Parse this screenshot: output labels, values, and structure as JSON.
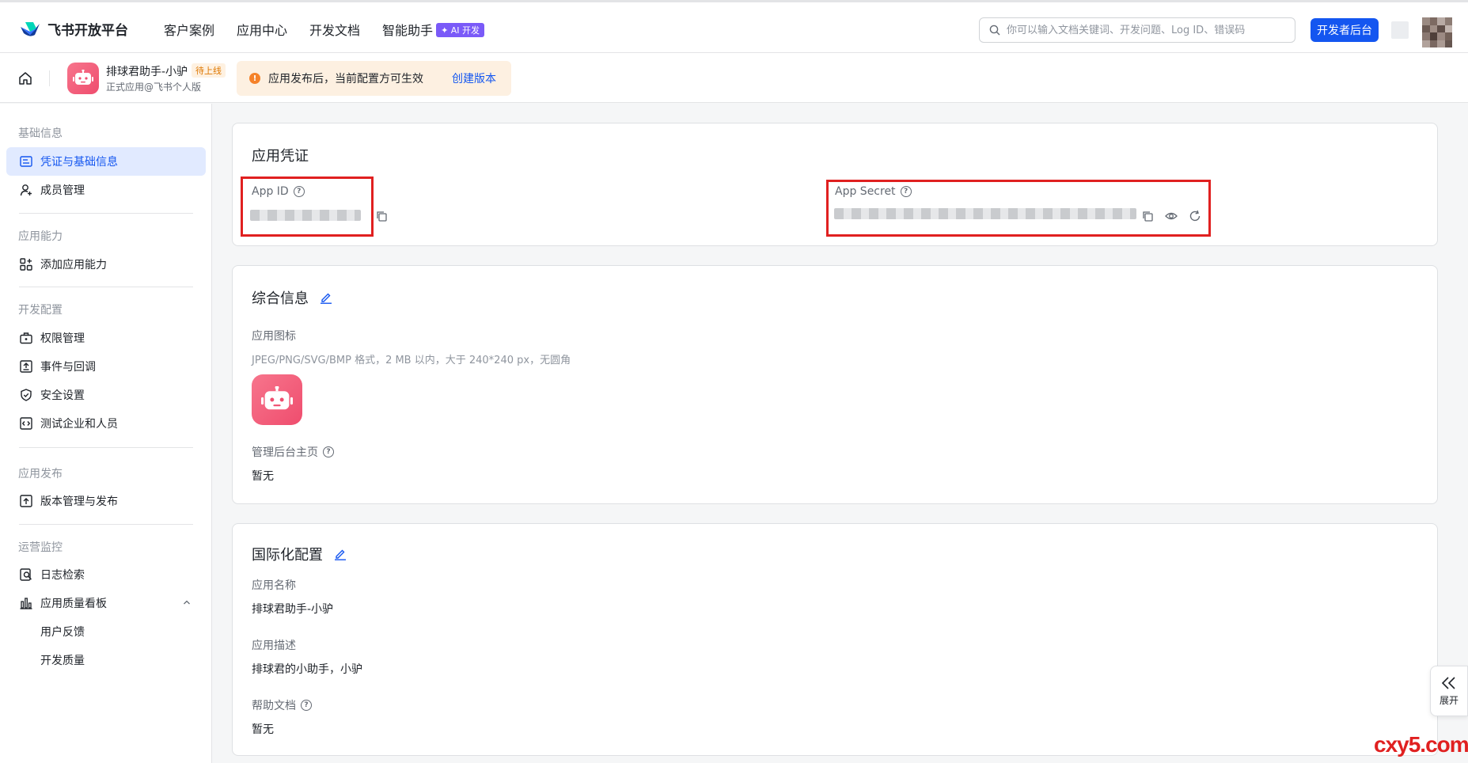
{
  "topbar": {
    "brand": "飞书开放平台",
    "nav": [
      "客户案例",
      "应用中心",
      "开发文档",
      "智能助手"
    ],
    "ai_badge": "✦ AI 开发",
    "search_placeholder": "你可以输入文档关键词、开发问题、Log ID、错误码",
    "dev_button": "开发者后台"
  },
  "subbar": {
    "app_name": "排球君助手-小驴",
    "app_status": "待上线",
    "app_subtitle": "正式应用@飞书个人版",
    "notice_text": "应用发布后，当前配置方可生效",
    "notice_link": "创建版本"
  },
  "sidebar": {
    "groups": [
      "基础信息",
      "应用能力",
      "开发配置",
      "应用发布",
      "运营监控"
    ],
    "items": {
      "credentials": "凭证与基础信息",
      "members": "成员管理",
      "add_capability": "添加应用能力",
      "permissions": "权限管理",
      "events": "事件与回调",
      "security": "安全设置",
      "test_enterprise": "测试企业和人员",
      "version": "版本管理与发布",
      "logs": "日志检索",
      "quality": "应用质量看板",
      "feedback": "用户反馈",
      "dev_quality": "开发质量"
    }
  },
  "credentials_card": {
    "title": "应用凭证",
    "app_id_label": "App ID",
    "app_secret_label": "App Secret"
  },
  "general_card": {
    "title": "综合信息",
    "icon_label": "应用图标",
    "icon_hint": "JPEG/PNG/SVG/BMP 格式，2 MB 以内，大于 240*240 px，无圆角",
    "homepage_label": "管理后台主页",
    "homepage_value": "暂无"
  },
  "i18n_card": {
    "title": "国际化配置",
    "name_label": "应用名称",
    "name_value": "排球君助手-小驴",
    "desc_label": "应用描述",
    "desc_value": "排球君的小助手，小驴",
    "help_label": "帮助文档",
    "help_value": "暂无"
  },
  "expand_label": "展开",
  "watermark": "cxy5.com",
  "colors": {
    "primary": "#1456f0",
    "highlight_box": "#e02020",
    "app_icon": "#ef4d6e"
  }
}
